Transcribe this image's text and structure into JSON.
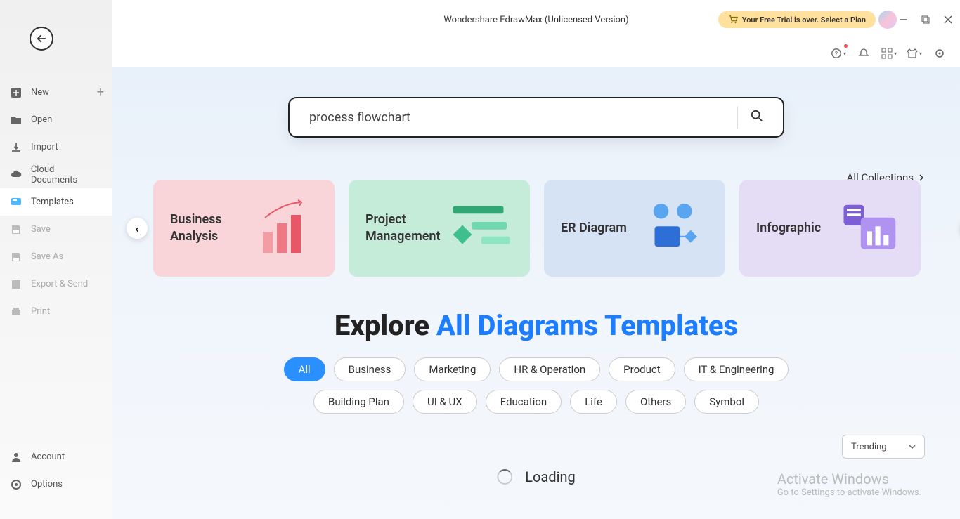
{
  "titlebar": {
    "title": "Wondershare EdrawMax (Unlicensed Version)",
    "trial_message": "Your Free Trial is over. Select a Plan"
  },
  "sidebar": {
    "items": [
      {
        "label": "New",
        "icon": "plus-square",
        "has_add": true
      },
      {
        "label": "Open",
        "icon": "folder"
      },
      {
        "label": "Import",
        "icon": "download"
      },
      {
        "label": "Cloud Documents",
        "icon": "cloud"
      },
      {
        "label": "Templates",
        "icon": "chat",
        "active": true
      },
      {
        "label": "Save",
        "icon": "save",
        "disabled": true
      },
      {
        "label": "Save As",
        "icon": "save-as",
        "disabled": true
      },
      {
        "label": "Export & Send",
        "icon": "export",
        "disabled": true
      },
      {
        "label": "Print",
        "icon": "print",
        "disabled": true
      }
    ],
    "bottom": [
      {
        "label": "Account",
        "icon": "user"
      },
      {
        "label": "Options",
        "icon": "gear"
      }
    ]
  },
  "search": {
    "value": "process flowchart",
    "placeholder": ""
  },
  "collections_link": "All Collections",
  "cards": [
    {
      "title": "Business\nAnalysis",
      "color": "business"
    },
    {
      "title": "Project\nManagement",
      "color": "project"
    },
    {
      "title": "ER Diagram",
      "color": "er"
    },
    {
      "title": "Infographic",
      "color": "info"
    }
  ],
  "explore": {
    "heading_prefix": "Explore ",
    "heading_highlight": "All Diagrams Templates"
  },
  "filters": [
    "All",
    "Business",
    "Marketing",
    "HR & Operation",
    "Product",
    "IT & Engineering",
    "Building Plan",
    "UI & UX",
    "Education",
    "Life",
    "Others",
    "Symbol"
  ],
  "active_filter": "All",
  "sort": {
    "selected": "Trending"
  },
  "loading_text": "Loading",
  "watermark": {
    "line1": "Activate Windows",
    "line2": "Go to Settings to activate Windows."
  }
}
